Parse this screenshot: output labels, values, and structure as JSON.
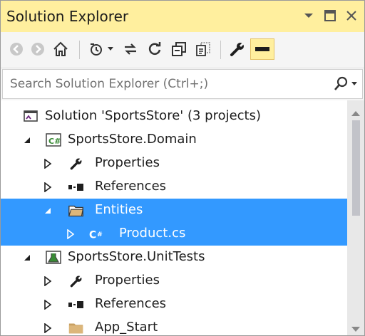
{
  "window": {
    "title": "Solution Explorer"
  },
  "search": {
    "placeholder": "Search Solution Explorer (Ctrl+;)"
  },
  "tree": {
    "solution_label": "Solution 'SportsStore' (3 projects)",
    "domain_project": "SportsStore.Domain",
    "domain_properties": "Properties",
    "domain_references": "References",
    "entities_folder": "Entities",
    "product_file": "Product.cs",
    "tests_project": "SportsStore.UnitTests",
    "tests_properties": "Properties",
    "tests_references": "References",
    "app_start_folder": "App_Start"
  },
  "colors": {
    "title_bar": "#ffef9e",
    "selection": "#3399ff",
    "csharp_green": "#388a34"
  }
}
